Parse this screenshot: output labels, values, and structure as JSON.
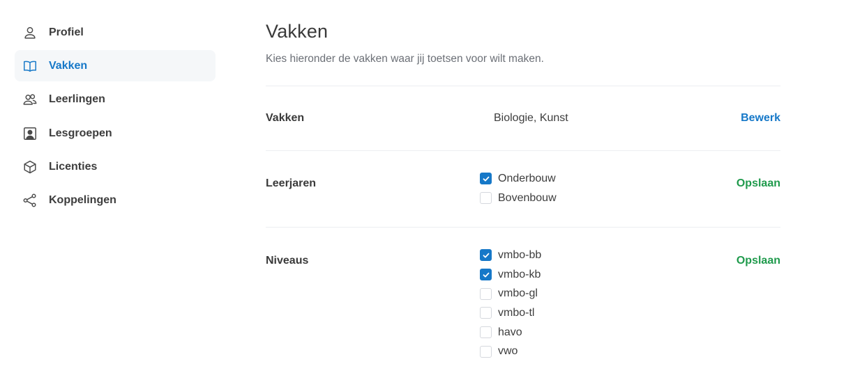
{
  "sidebar": {
    "items": [
      {
        "label": "Profiel",
        "icon": "user-icon",
        "active": false
      },
      {
        "label": "Vakken",
        "icon": "book-icon",
        "active": true
      },
      {
        "label": "Leerlingen",
        "icon": "users-icon",
        "active": false
      },
      {
        "label": "Lesgroepen",
        "icon": "group-portrait-icon",
        "active": false
      },
      {
        "label": "Licenties",
        "icon": "cube-icon",
        "active": false
      },
      {
        "label": "Koppelingen",
        "icon": "share-icon",
        "active": false
      }
    ]
  },
  "main": {
    "title": "Vakken",
    "subtitle": "Kies hieronder de vakken waar jij toetsen voor wilt maken.",
    "rows": {
      "vakken": {
        "label": "Vakken",
        "value": "Biologie, Kunst",
        "action": "Bewerk"
      },
      "leerjaren": {
        "label": "Leerjaren",
        "action": "Opslaan",
        "options": [
          {
            "label": "Onderbouw",
            "checked": true
          },
          {
            "label": "Bovenbouw",
            "checked": false
          }
        ]
      },
      "niveaus": {
        "label": "Niveaus",
        "action": "Opslaan",
        "options": [
          {
            "label": "vmbo-bb",
            "checked": true
          },
          {
            "label": "vmbo-kb",
            "checked": true
          },
          {
            "label": "vmbo-gl",
            "checked": false
          },
          {
            "label": "vmbo-tl",
            "checked": false
          },
          {
            "label": "havo",
            "checked": false
          },
          {
            "label": "vwo",
            "checked": false
          }
        ]
      }
    }
  },
  "colors": {
    "accent": "#1678c8",
    "save": "#1f9a4c",
    "active_bg": "#f5f7f9"
  }
}
